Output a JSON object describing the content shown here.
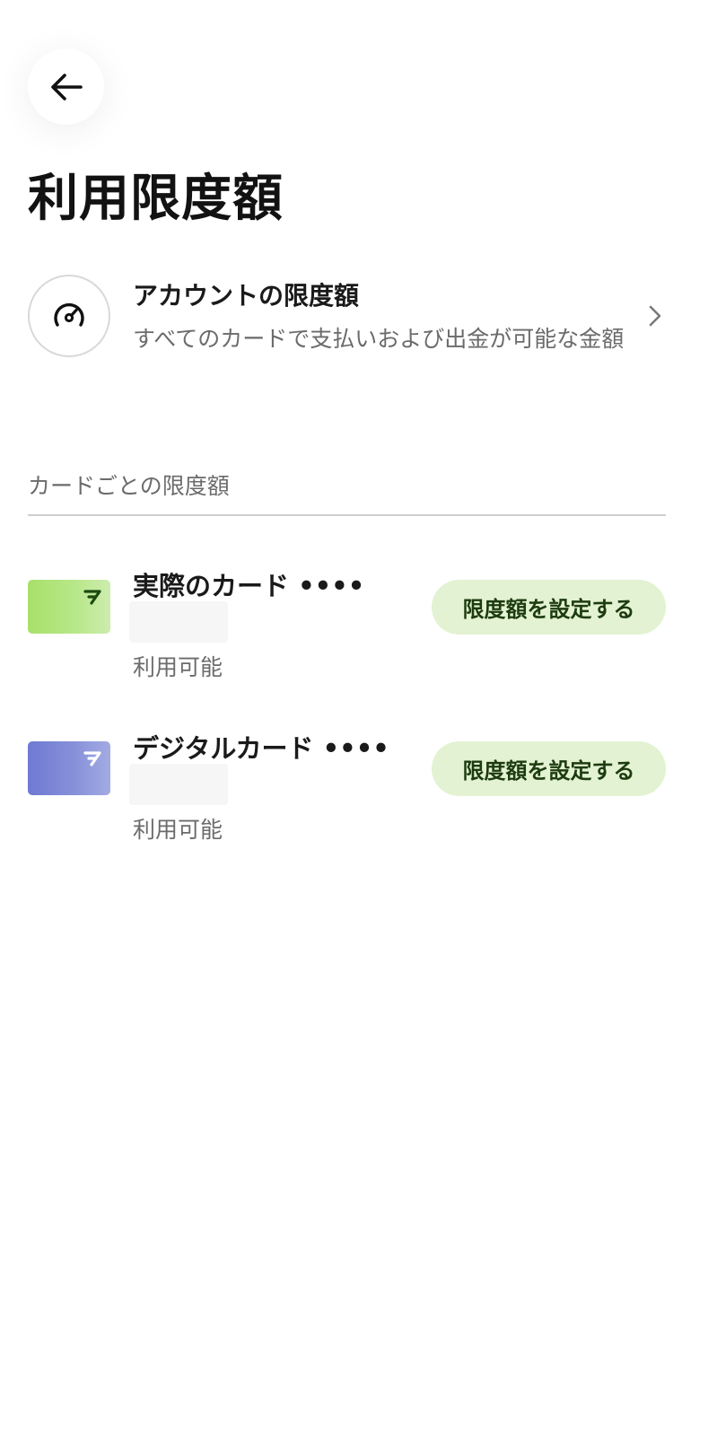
{
  "header": {
    "back_icon": "arrow-left-icon",
    "title": "利用限度額"
  },
  "account_limit": {
    "icon": "gauge-icon",
    "title": "アカウントの限度額",
    "subtitle": "すべてのカードで支払いおよび出金が可能な金額",
    "chevron_icon": "chevron-right-icon"
  },
  "card_limits": {
    "section_label": "カードごとの限度額",
    "cards": [
      {
        "name": "実際のカード ••••",
        "status": "利用可能",
        "button_label": "限度額を設定する",
        "thumb_color": "#a8e06a",
        "logo_color": "#1d4a10"
      },
      {
        "name": "デジタルカード ••••",
        "status": "利用可能",
        "button_label": "限度額を設定する",
        "thumb_color": "#6f7ad3",
        "logo_color": "#ffffff"
      }
    ]
  },
  "colors": {
    "accent_button_bg": "#e3f2d2",
    "accent_button_text": "#1d3b10",
    "secondary_text": "#6b6b6b"
  }
}
